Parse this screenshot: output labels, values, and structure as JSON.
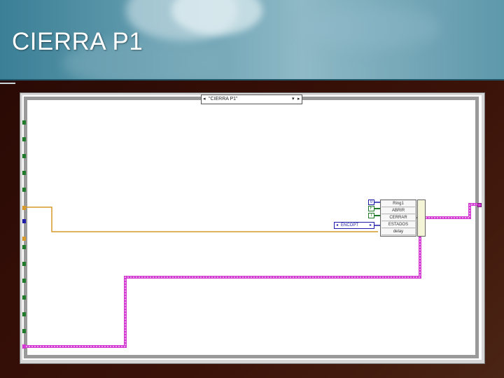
{
  "slide": {
    "title": "CIERRA P1"
  },
  "diagram": {
    "case_selector": {
      "left_arrow": "◂",
      "label": "\"CIERRA P1\"",
      "dropdown": "▾",
      "right_arrow": "▸"
    },
    "constants": {
      "num_zero": "0",
      "bool_false": "F",
      "bool_true": "T"
    },
    "enum_constant": {
      "left_arrow": "◂",
      "label": "ENCOPT",
      "right_arrow": "▸"
    },
    "bundle_fields": [
      "Ring1",
      "ABRIR",
      "CERRAR",
      "ESTADOS",
      "delay"
    ]
  },
  "colors": {
    "wire_pink": "#d23ad2",
    "wire_orange": "#d89a2a",
    "tunnel_green": "#1f7a2a",
    "tunnel_blue": "#1d1da8"
  }
}
